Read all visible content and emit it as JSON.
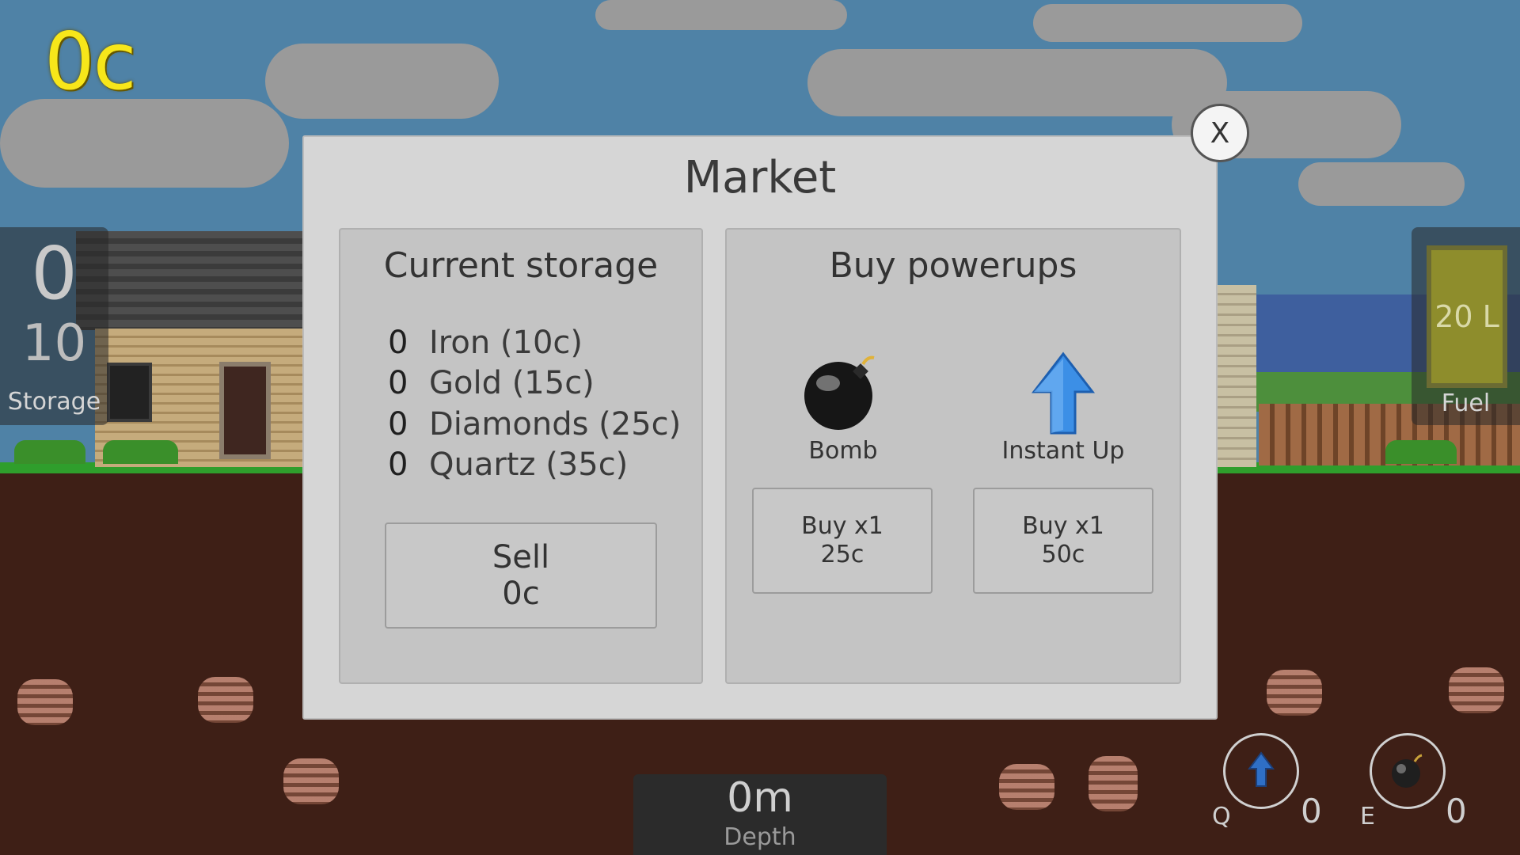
{
  "hud": {
    "coins": "0c",
    "storage": {
      "count": "0",
      "max": "10",
      "label": "Storage"
    },
    "fuel": {
      "value": "20 L",
      "label": "Fuel"
    },
    "depth": {
      "value": "0m",
      "label": "Depth"
    },
    "slots": [
      {
        "key": "Q",
        "icon": "instant-up-icon",
        "count": "0"
      },
      {
        "key": "E",
        "icon": "bomb-icon",
        "count": "0"
      }
    ]
  },
  "market": {
    "title": "Market",
    "close_label": "X",
    "storage": {
      "title": "Current storage",
      "items": [
        {
          "count": "0",
          "label": "Iron (10c)"
        },
        {
          "count": "0",
          "label": "Gold (15c)"
        },
        {
          "count": "0",
          "label": "Diamonds (25c)"
        },
        {
          "count": "0",
          "label": "Quartz (35c)"
        }
      ],
      "sell": {
        "line1": "Sell",
        "line2": "0c"
      }
    },
    "powerups": {
      "title": "Buy powerups",
      "items": [
        {
          "name": "Bomb",
          "icon": "bomb-icon",
          "buy_line1": "Buy x1",
          "buy_line2": "25c"
        },
        {
          "name": "Instant Up",
          "icon": "instant-up-icon",
          "buy_line1": "Buy x1",
          "buy_line2": "50c"
        }
      ]
    }
  },
  "colors": {
    "coins": "#f7e61a",
    "sky": "#4f82a6",
    "ground": "#3e1f16",
    "panel": "#d6d6d6"
  }
}
